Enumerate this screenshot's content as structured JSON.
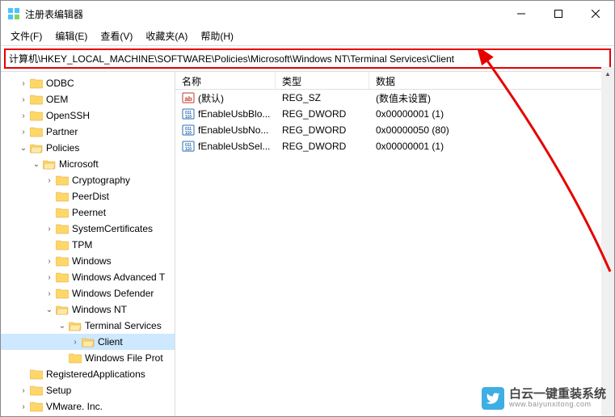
{
  "titlebar": {
    "title": "注册表编辑器"
  },
  "menu": {
    "file": "文件(F)",
    "edit": "编辑(E)",
    "view": "查看(V)",
    "favorites": "收藏夹(A)",
    "help": "帮助(H)"
  },
  "address": "计算机\\HKEY_LOCAL_MACHINE\\SOFTWARE\\Policies\\Microsoft\\Windows NT\\Terminal Services\\Client",
  "columns": {
    "name": "名称",
    "type": "类型",
    "data": "数据"
  },
  "tree": [
    {
      "label": "ODBC",
      "level": 1,
      "expander": ">"
    },
    {
      "label": "OEM",
      "level": 1,
      "expander": ">"
    },
    {
      "label": "OpenSSH",
      "level": 1,
      "expander": ">"
    },
    {
      "label": "Partner",
      "level": 1,
      "expander": ">"
    },
    {
      "label": "Policies",
      "level": 1,
      "expander": "v"
    },
    {
      "label": "Microsoft",
      "level": 2,
      "expander": "v"
    },
    {
      "label": "Cryptography",
      "level": 3,
      "expander": ">"
    },
    {
      "label": "PeerDist",
      "level": 3,
      "expander": ""
    },
    {
      "label": "Peernet",
      "level": 3,
      "expander": ""
    },
    {
      "label": "SystemCertificates",
      "level": 3,
      "expander": ">"
    },
    {
      "label": "TPM",
      "level": 3,
      "expander": ""
    },
    {
      "label": "Windows",
      "level": 3,
      "expander": ">"
    },
    {
      "label": "Windows Advanced T",
      "level": 3,
      "expander": ">"
    },
    {
      "label": "Windows Defender",
      "level": 3,
      "expander": ">"
    },
    {
      "label": "Windows NT",
      "level": 3,
      "expander": "v"
    },
    {
      "label": "Terminal Services",
      "level": 4,
      "expander": "v"
    },
    {
      "label": "Client",
      "level": 5,
      "expander": ">",
      "selected": true
    },
    {
      "label": "Windows File Prot",
      "level": 4,
      "expander": ""
    },
    {
      "label": "RegisteredApplications",
      "level": 1,
      "expander": ""
    },
    {
      "label": "Setup",
      "level": 1,
      "expander": ">"
    },
    {
      "label": "VMware. Inc.",
      "level": 1,
      "expander": ">"
    }
  ],
  "rows": [
    {
      "icon": "string",
      "name": "(默认)",
      "type": "REG_SZ",
      "data": "(数值未设置)"
    },
    {
      "icon": "dword",
      "name": "fEnableUsbBlo...",
      "type": "REG_DWORD",
      "data": "0x00000001 (1)"
    },
    {
      "icon": "dword",
      "name": "fEnableUsbNo...",
      "type": "REG_DWORD",
      "data": "0x00000050 (80)"
    },
    {
      "icon": "dword",
      "name": "fEnableUsbSel...",
      "type": "REG_DWORD",
      "data": "0x00000001 (1)"
    }
  ],
  "watermark": {
    "cn": "白云一键重装系统",
    "en": "www.baiyunxitong.com"
  }
}
